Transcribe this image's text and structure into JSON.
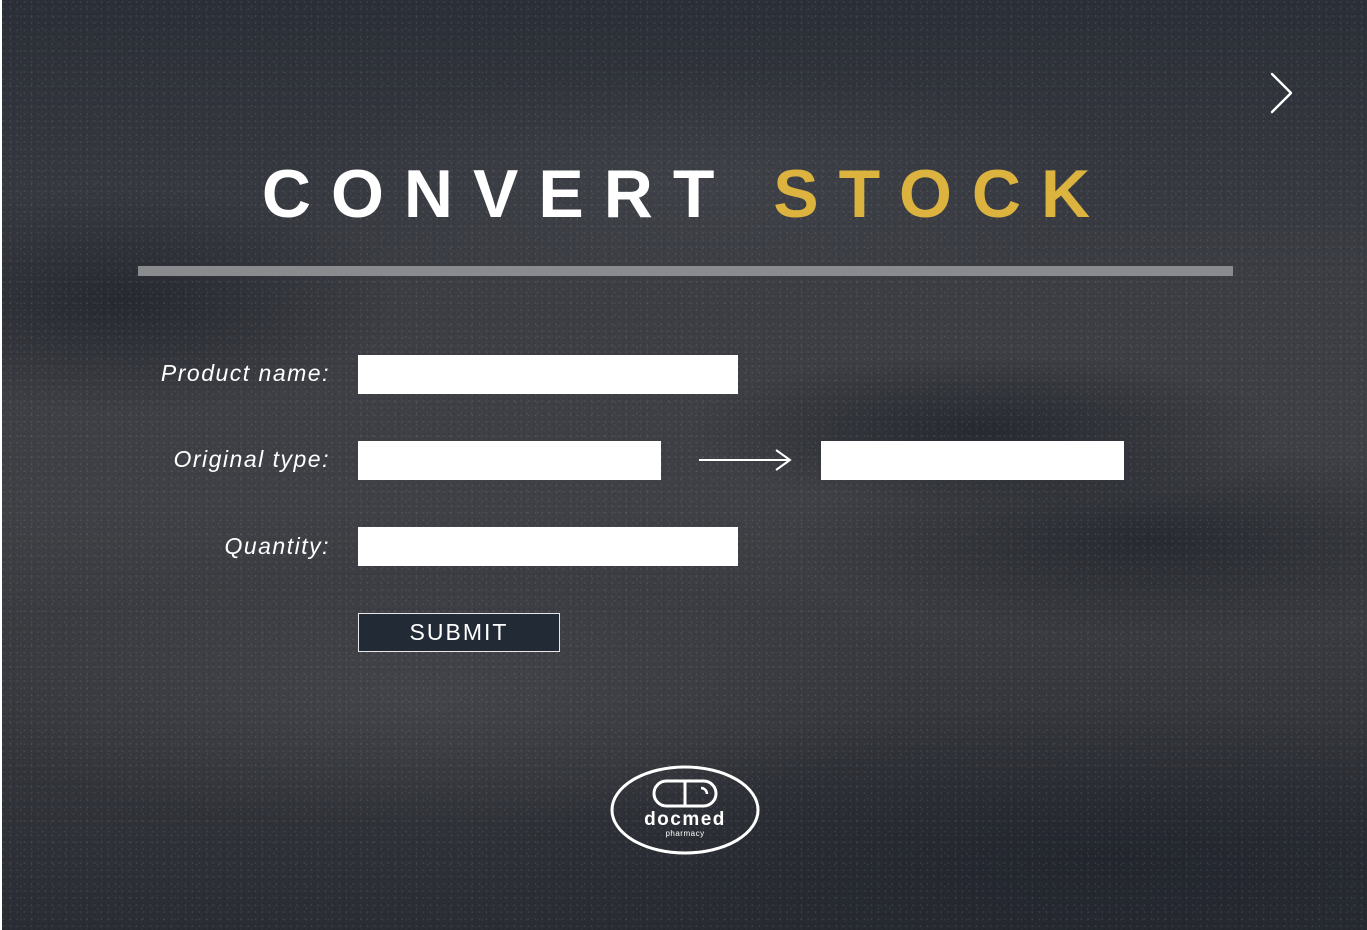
{
  "title": {
    "word1": "CONVERT",
    "word2": "STOCK"
  },
  "colors": {
    "accent": "#dbb33e",
    "title_primary": "#ffffff",
    "divider": "#8a8b8e",
    "button_bg": "#222a35"
  },
  "navigation": {
    "next_icon": "chevron-right-icon"
  },
  "form": {
    "product_name_label": "Product name:",
    "product_name_value": "",
    "original_type_label": "Original type:",
    "original_type_value": "",
    "target_type_value": "",
    "convert_icon": "arrow-right-icon",
    "quantity_label": "Quantity:",
    "quantity_value": "",
    "submit_label": "SUBMIT"
  },
  "logo": {
    "icon": "capsule-icon",
    "name": "docmed",
    "subtitle": "pharmacy"
  }
}
